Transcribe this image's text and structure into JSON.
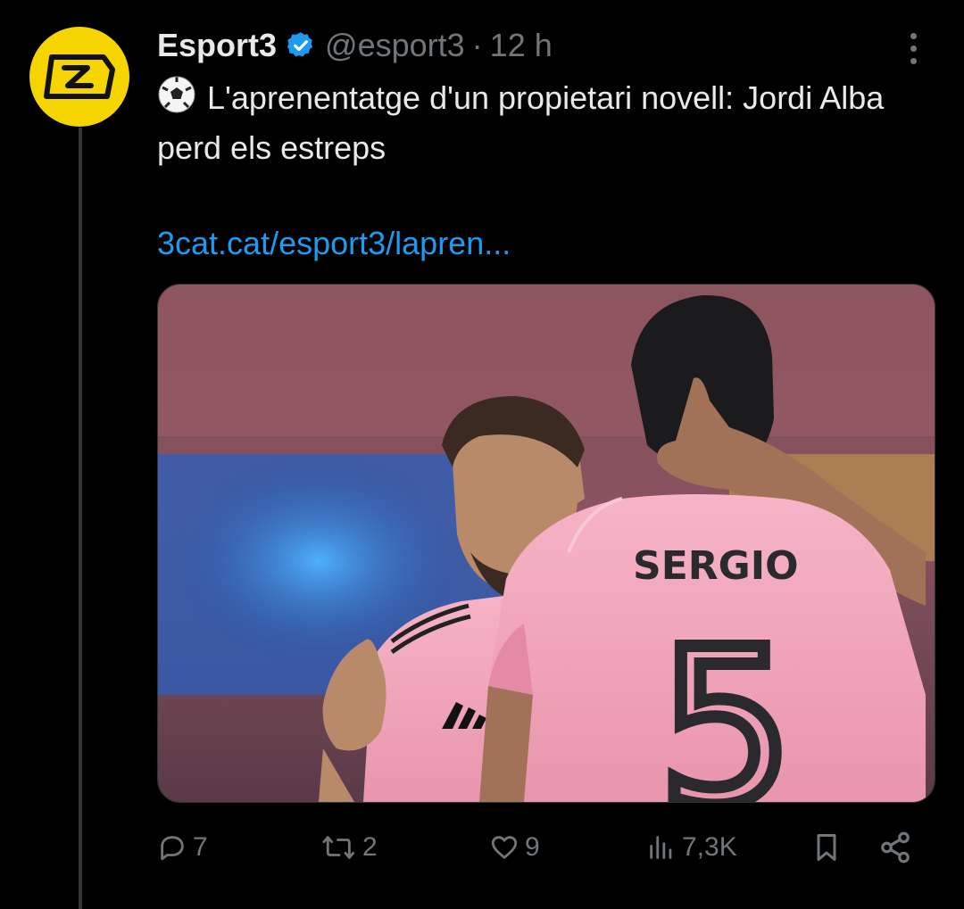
{
  "tweet": {
    "author_name": "Esport3",
    "handle": "@esport3",
    "separator": "·",
    "time": "12 h",
    "text": "L'aprenentatge d'un propietari novell: Jordi Alba perd els estreps",
    "link": "3cat.cat/esport3/lapren...",
    "media": {
      "jersey_name": "SERGIO",
      "jersey_number": "5"
    }
  },
  "actions": {
    "replies": "7",
    "reposts": "2",
    "likes": "9",
    "views": "7,3K"
  },
  "icons": [
    "more-icon",
    "verified-icon",
    "soccer-ball-icon",
    "reply-icon",
    "repost-icon",
    "like-icon",
    "views-icon",
    "bookmark-icon",
    "share-icon"
  ],
  "colors": {
    "accent": "#1d9bf0",
    "muted": "#71767b",
    "text": "#e7e9ea",
    "brand": "#f5d400"
  }
}
